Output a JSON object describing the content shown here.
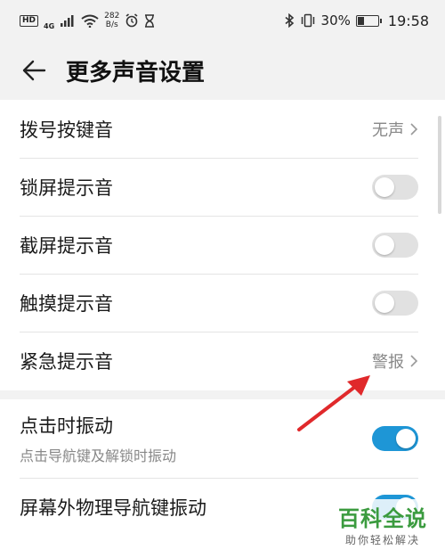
{
  "status_bar": {
    "hd": "HD",
    "net_type": "4G",
    "speed_value": "282",
    "speed_unit": "B/s",
    "battery": "30%",
    "time": "19:58"
  },
  "app_bar": {
    "title": "更多声音设置",
    "back_icon": "arrow-left-icon"
  },
  "settings": {
    "dial_tone": {
      "label": "拨号按键音",
      "value": "无声"
    },
    "lock_sound": {
      "label": "锁屏提示音",
      "state": "off"
    },
    "screenshot_sound": {
      "label": "截屏提示音",
      "state": "off"
    },
    "touch_sound": {
      "label": "触摸提示音",
      "state": "off"
    },
    "emergency_sound": {
      "label": "紧急提示音",
      "value": "警报"
    },
    "vibrate_on_tap": {
      "label": "点击时振动",
      "sublabel": "点击导航键及解锁时振动",
      "state": "on"
    },
    "offscreen_nav_vibrate": {
      "label": "屏幕外物理导航键振动",
      "state": "on"
    }
  },
  "watermark": {
    "main": "百科全说",
    "sub": "助你轻松解决"
  },
  "colors": {
    "accent": "#1e96d6",
    "annotation": "#e0292b",
    "watermark": "#3b9b3f"
  }
}
